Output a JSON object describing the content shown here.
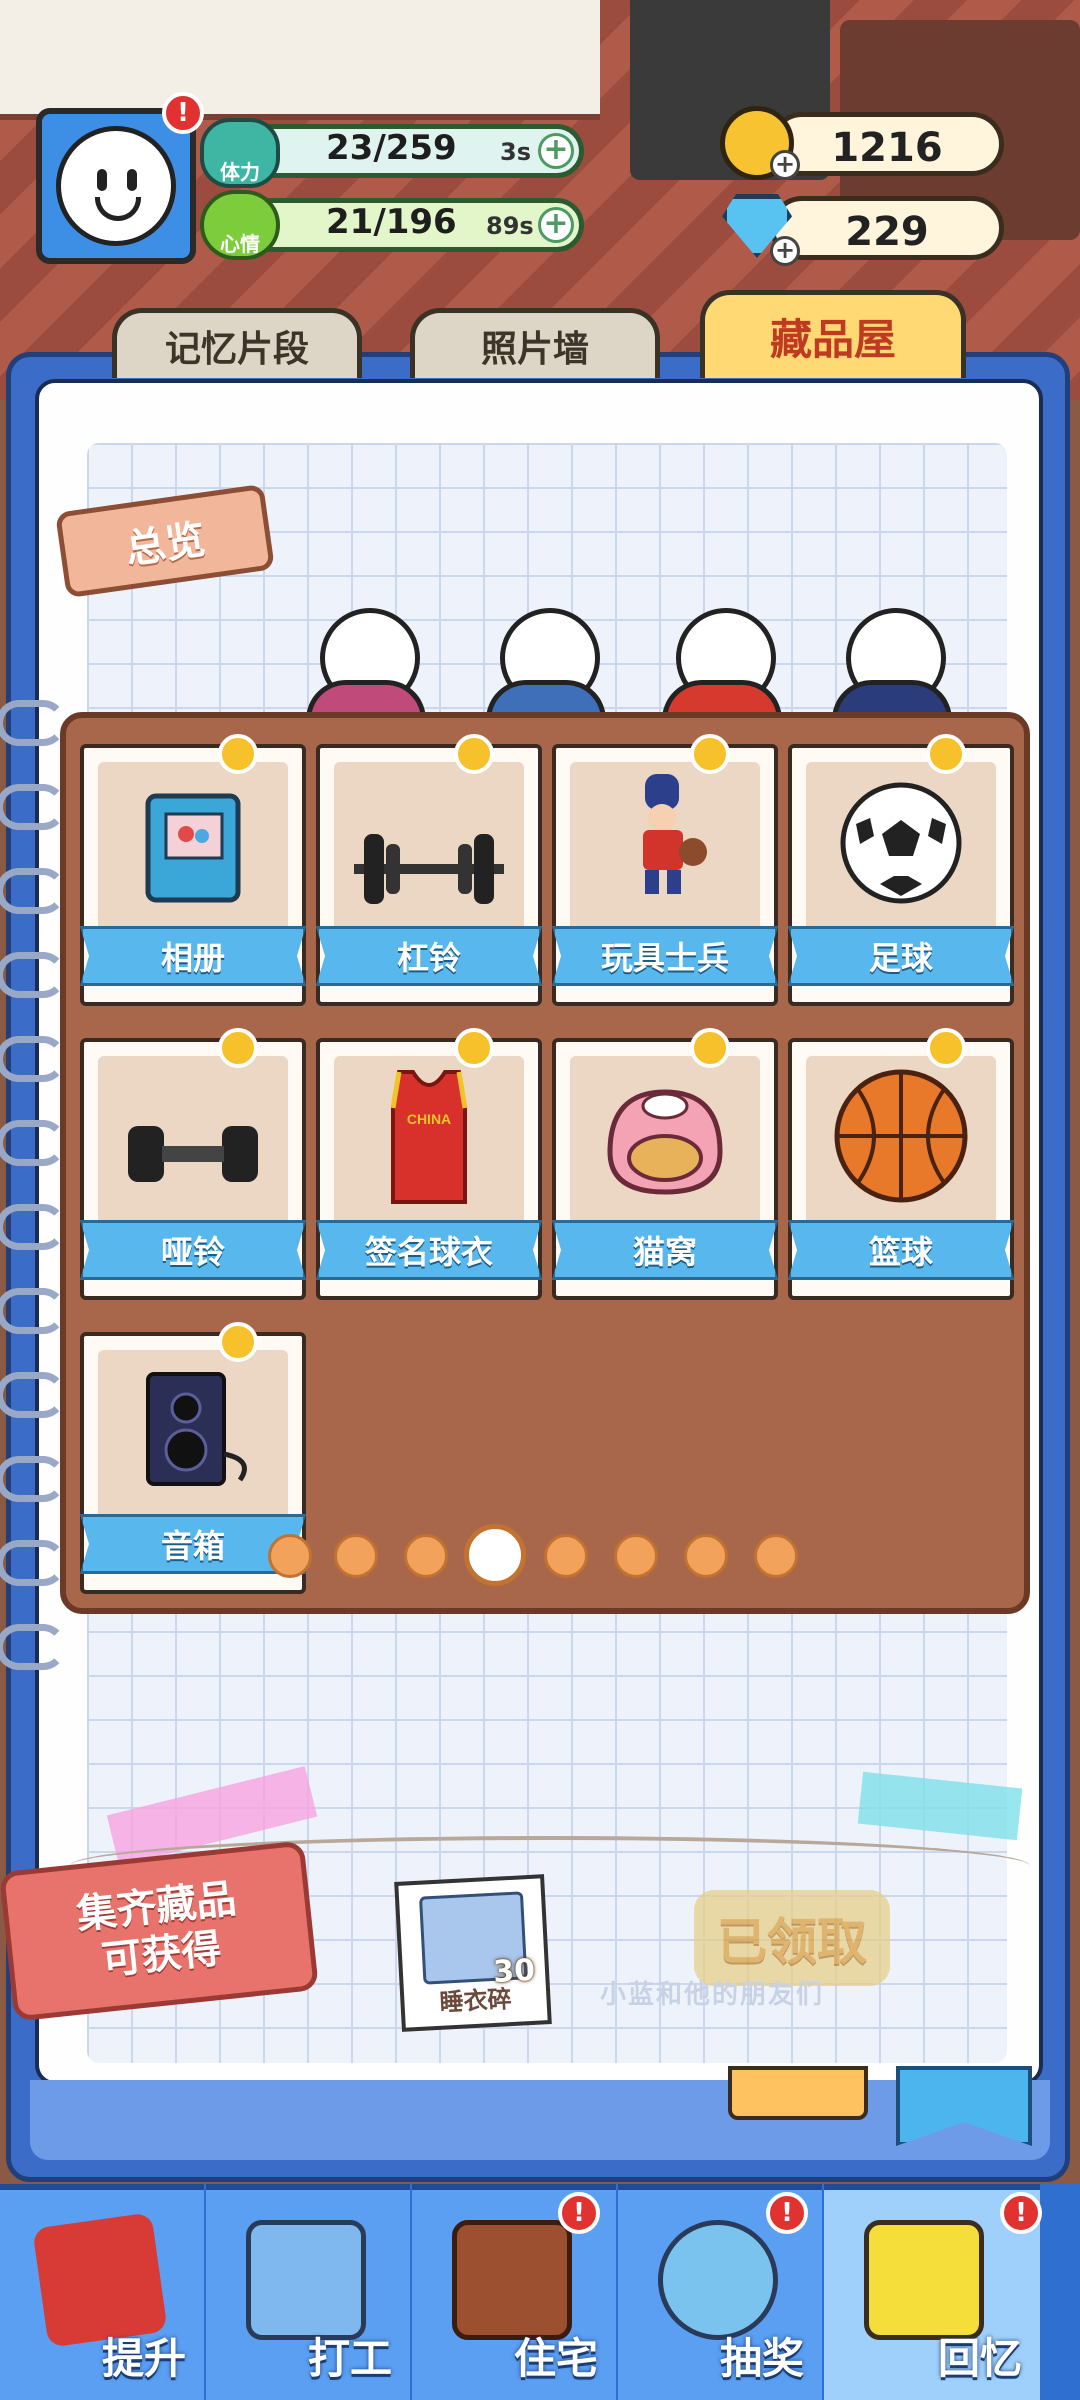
{
  "hud": {
    "energy": {
      "label": "体力",
      "value": "23/259",
      "timer": "3s"
    },
    "mood": {
      "label": "心情",
      "value": "21/196",
      "timer": "89s"
    },
    "coins": "1216",
    "gems": "229"
  },
  "tabs": [
    {
      "label": "记忆片段"
    },
    {
      "label": "照片墙"
    },
    {
      "label": "藏品屋"
    }
  ],
  "overview_label": "总览",
  "items": [
    {
      "name": "相册"
    },
    {
      "name": "杠铃"
    },
    {
      "name": "玩具士兵"
    },
    {
      "name": "足球"
    },
    {
      "name": "哑铃"
    },
    {
      "name": "签名球衣"
    },
    {
      "name": "猫窝"
    },
    {
      "name": "篮球"
    },
    {
      "name": "音箱"
    }
  ],
  "jersey_text": "CHINA",
  "pager": {
    "total": 8,
    "active_index": 3
  },
  "reward": {
    "tag_line1": "集齐藏品",
    "tag_line2": "可获得",
    "item_name": "睡衣碎",
    "item_count": "30",
    "claim_button": "已领取",
    "faded_caption": "小蓝和他的朋友们"
  },
  "nav": [
    {
      "label": "提升"
    },
    {
      "label": "打工"
    },
    {
      "label": "住宅"
    },
    {
      "label": "抽奖"
    },
    {
      "label": "回忆"
    }
  ],
  "colors": {
    "board": "#a8674a",
    "ribbon": "#58b7ec",
    "nav": "#2f6fd0",
    "alert": "#e23131"
  }
}
